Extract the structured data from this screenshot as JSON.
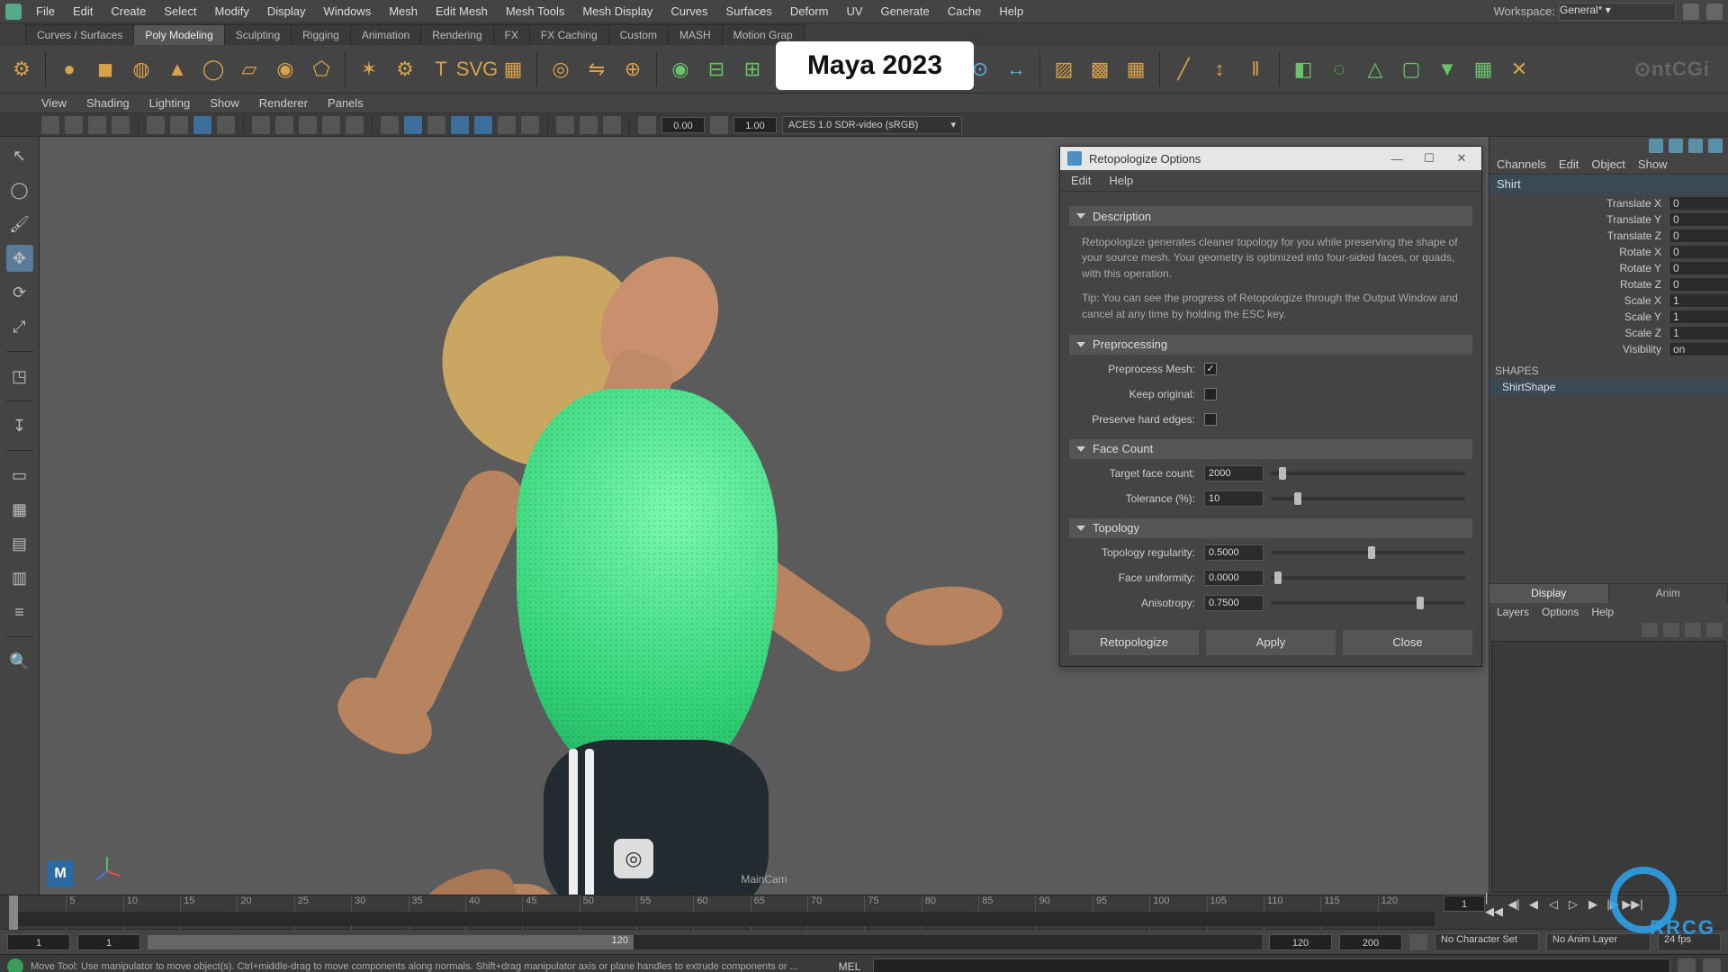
{
  "menubar": [
    "File",
    "Edit",
    "Create",
    "Select",
    "Modify",
    "Display",
    "Windows",
    "Mesh",
    "Edit Mesh",
    "Mesh Tools",
    "Mesh Display",
    "Curves",
    "Surfaces",
    "Deform",
    "UV",
    "Generate",
    "Cache",
    "Help"
  ],
  "workspace": {
    "label": "Workspace:",
    "value": "General*"
  },
  "shelfTabs": [
    "Curves / Surfaces",
    "Poly Modeling",
    "Sculpting",
    "Rigging",
    "Animation",
    "Rendering",
    "FX",
    "FX Caching",
    "Custom",
    "MASH",
    "Motion Grap"
  ],
  "shelfActive": 1,
  "versionLabel": "Maya 2023",
  "panelMenu": [
    "View",
    "Shading",
    "Lighting",
    "Show",
    "Renderer",
    "Panels"
  ],
  "panelToolbar": {
    "num1": "0.00",
    "num2": "1.00",
    "colorspace": "ACES 1.0 SDR-video (sRGB)"
  },
  "camera": "MainCam",
  "brand": "⊙ntCGi",
  "dialog": {
    "title": "Retopologize Options",
    "menus": [
      "Edit",
      "Help"
    ],
    "sections": {
      "desc": {
        "title": "Description",
        "body": "Retopologize generates cleaner topology for you while preserving the shape of your source mesh. Your geometry is optimized into four-sided faces, or quads, with this operation.",
        "tip": "Tip: You can see the progress of Retopologize through the Output Window and cancel at any time by holding the ESC key."
      },
      "pre": {
        "title": "Preprocessing",
        "preprocess": {
          "label": "Preprocess Mesh:",
          "checked": true
        },
        "keep": {
          "label": "Keep original:",
          "checked": false
        },
        "hard": {
          "label": "Preserve hard edges:",
          "checked": false
        }
      },
      "face": {
        "title": "Face Count",
        "target": {
          "label": "Target face count:",
          "value": "2000",
          "knob": 4
        },
        "tol": {
          "label": "Tolerance (%):",
          "value": "10",
          "knob": 12
        }
      },
      "topo": {
        "title": "Topology",
        "reg": {
          "label": "Topology regularity:",
          "value": "0.5000",
          "knob": 50
        },
        "uni": {
          "label": "Face uniformity:",
          "value": "0.0000",
          "knob": 2
        },
        "ani": {
          "label": "Anisotropy:",
          "value": "0.7500",
          "knob": 75
        }
      }
    },
    "buttons": [
      "Retopologize",
      "Apply",
      "Close"
    ]
  },
  "channel": {
    "menus": [
      "Channels",
      "Edit",
      "Object",
      "Show"
    ],
    "object": "Shirt",
    "attrs": [
      {
        "l": "Translate X",
        "v": "0"
      },
      {
        "l": "Translate Y",
        "v": "0"
      },
      {
        "l": "Translate Z",
        "v": "0"
      },
      {
        "l": "Rotate X",
        "v": "0"
      },
      {
        "l": "Rotate Y",
        "v": "0"
      },
      {
        "l": "Rotate Z",
        "v": "0"
      },
      {
        "l": "Scale X",
        "v": "1"
      },
      {
        "l": "Scale Y",
        "v": "1"
      },
      {
        "l": "Scale Z",
        "v": "1"
      },
      {
        "l": "Visibility",
        "v": "on"
      }
    ],
    "shapesLabel": "SHAPES",
    "shape": "ShirtShape",
    "layerTabs": [
      "Display",
      "Anim"
    ],
    "layerMenu": [
      "Layers",
      "Options",
      "Help"
    ]
  },
  "timeline": {
    "ticks": [
      "1",
      "5",
      "10",
      "15",
      "20",
      "25",
      "30",
      "35",
      "40",
      "45",
      "50",
      "55",
      "60",
      "65",
      "70",
      "75",
      "80",
      "85",
      "90",
      "95",
      "100",
      "105",
      "110",
      "115",
      "120"
    ],
    "cur": "1"
  },
  "range": {
    "start": "1",
    "inStart": "1",
    "inEnd": "120",
    "end": "200",
    "endOut": "120",
    "charset": "No Character Set",
    "animlayer": "No Anim Layer",
    "fps": "24 fps"
  },
  "help": "Move Tool: Use manipulator to move object(s). Ctrl+middle-drag to move components along normals. Shift+drag manipulator axis or plane handles to extrude components or ...",
  "cmd": "MEL"
}
